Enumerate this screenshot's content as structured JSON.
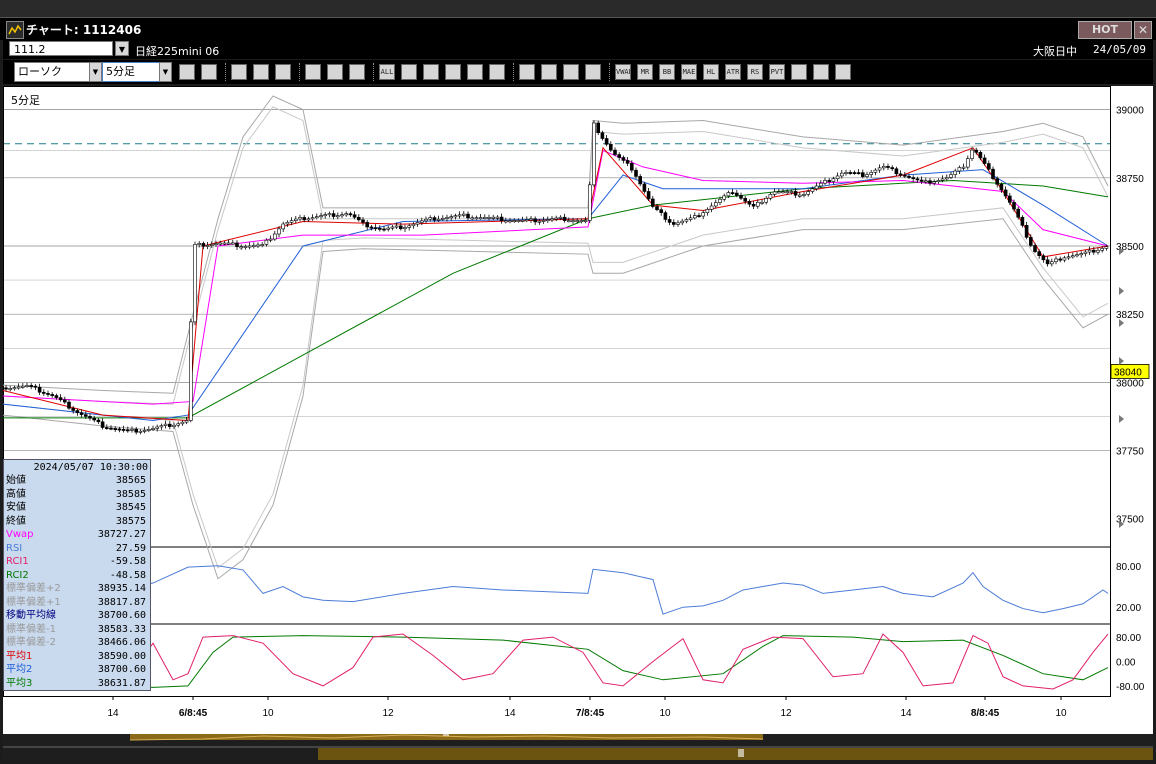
{
  "window": {
    "title": "チャート: 1112406",
    "hot_label": "HOT",
    "close_label": "✕"
  },
  "info": {
    "symbol_code": "111.2",
    "name": "日経225mini 06",
    "exchange": "大阪日中",
    "date": "24/05/09"
  },
  "toolbar": {
    "chart_type": "ローソク",
    "interval": "5分足",
    "buttons": [
      "zoom",
      "range",
      "bug",
      "clock",
      "crosshair",
      "grid",
      "candle",
      "candle2",
      "ALL",
      "pen",
      "line",
      "cursor",
      "undo",
      "note",
      "trash",
      "settings",
      "brush",
      "palette",
      "VWAP",
      "MR",
      "BB",
      "MAE",
      "HL",
      "ATR",
      "RS",
      "PVT",
      "box",
      "Log",
      "export"
    ]
  },
  "chart": {
    "label": "5分足",
    "y_ticks": [
      "39000",
      "38750",
      "38500",
      "38250",
      "38000",
      "37750",
      "37500"
    ],
    "current_price": "38040",
    "rsi_ticks": [
      "80.00",
      "20.00"
    ],
    "rci_ticks": [
      "80.00",
      "0.00",
      "-80.00"
    ],
    "x_ticks": [
      "14",
      "6/8:45",
      "10",
      "12",
      "14",
      "7/8:45",
      "10",
      "12",
      "14",
      "8/8:45",
      "10"
    ],
    "dashed_line_value": 38875
  },
  "datapanel": {
    "timestamp": "2024/05/07  10:30:00",
    "rows": [
      {
        "k": "始値",
        "v": "38565",
        "c": "#000000"
      },
      {
        "k": "高値",
        "v": "38585",
        "c": "#000000"
      },
      {
        "k": "安値",
        "v": "38545",
        "c": "#000000"
      },
      {
        "k": "終値",
        "v": "38575",
        "c": "#000000"
      },
      {
        "k": "Vwap",
        "v": "38727.27",
        "c": "#ff00ff"
      },
      {
        "k": "RSI",
        "v": "27.59",
        "c": "#4c7cd6"
      },
      {
        "k": "RCI1",
        "v": "-59.58",
        "c": "#e0206a"
      },
      {
        "k": "RCI2",
        "v": "-48.58",
        "c": "#007a00"
      },
      {
        "k": "標準偏差+2",
        "v": "38935.14",
        "c": "#9a9a9a"
      },
      {
        "k": "標準偏差+1",
        "v": "38817.87",
        "c": "#9a9a9a"
      },
      {
        "k": "移動平均線",
        "v": "38700.60",
        "c": "#000080"
      },
      {
        "k": "標準偏差-1",
        "v": "38583.33",
        "c": "#9a9a9a"
      },
      {
        "k": "標準偏差-2",
        "v": "38466.06",
        "c": "#9a9a9a"
      },
      {
        "k": "平均1",
        "v": "38590.00",
        "c": "#e00000"
      },
      {
        "k": "平均2",
        "v": "38700.60",
        "c": "#1f5fd8"
      },
      {
        "k": "平均3",
        "v": "38631.87",
        "c": "#007a00"
      }
    ]
  },
  "chart_data": {
    "type": "line",
    "title": "5分足",
    "ylim": [
      37400,
      39050
    ],
    "close_path": [
      [
        0,
        37980
      ],
      [
        25,
        37985
      ],
      [
        50,
        37950
      ],
      [
        75,
        37890
      ],
      [
        100,
        37840
      ],
      [
        125,
        37820
      ],
      [
        150,
        37830
      ],
      [
        175,
        37850
      ],
      [
        185,
        37860
      ],
      [
        190,
        38500
      ],
      [
        215,
        38510
      ],
      [
        240,
        38500
      ],
      [
        260,
        38500
      ],
      [
        280,
        38580
      ],
      [
        300,
        38600
      ],
      [
        320,
        38610
      ],
      [
        345,
        38620
      ],
      [
        360,
        38580
      ],
      [
        380,
        38560
      ],
      [
        400,
        38570
      ],
      [
        430,
        38600
      ],
      [
        460,
        38610
      ],
      [
        490,
        38600
      ],
      [
        520,
        38590
      ],
      [
        560,
        38600
      ],
      [
        585,
        38590
      ],
      [
        590,
        38950
      ],
      [
        610,
        38840
      ],
      [
        630,
        38780
      ],
      [
        650,
        38640
      ],
      [
        670,
        38580
      ],
      [
        690,
        38600
      ],
      [
        710,
        38650
      ],
      [
        730,
        38700
      ],
      [
        750,
        38640
      ],
      [
        770,
        38700
      ],
      [
        800,
        38690
      ],
      [
        815,
        38720
      ],
      [
        840,
        38770
      ],
      [
        860,
        38760
      ],
      [
        880,
        38790
      ],
      [
        900,
        38760
      ],
      [
        920,
        38730
      ],
      [
        945,
        38750
      ],
      [
        960,
        38790
      ],
      [
        970,
        38860
      ],
      [
        985,
        38780
      ],
      [
        1000,
        38700
      ],
      [
        1010,
        38640
      ],
      [
        1030,
        38490
      ],
      [
        1045,
        38430
      ],
      [
        1060,
        38460
      ],
      [
        1080,
        38470
      ],
      [
        1105,
        38500
      ]
    ],
    "bb_upper": [
      [
        0,
        37990
      ],
      [
        100,
        37970
      ],
      [
        170,
        37960
      ],
      [
        190,
        38250
      ],
      [
        215,
        38600
      ],
      [
        240,
        38900
      ],
      [
        270,
        39050
      ],
      [
        300,
        39000
      ],
      [
        320,
        38640
      ],
      [
        360,
        38640
      ],
      [
        585,
        38640
      ],
      [
        590,
        38960
      ],
      [
        620,
        38950
      ],
      [
        700,
        38960
      ],
      [
        800,
        38900
      ],
      [
        900,
        38870
      ],
      [
        1000,
        38920
      ],
      [
        1040,
        38950
      ],
      [
        1080,
        38900
      ],
      [
        1105,
        38720
      ]
    ],
    "bb_lower": [
      [
        0,
        37880
      ],
      [
        100,
        37840
      ],
      [
        170,
        37820
      ],
      [
        190,
        37550
      ],
      [
        215,
        37280
      ],
      [
        240,
        37350
      ],
      [
        270,
        37550
      ],
      [
        300,
        37950
      ],
      [
        320,
        38480
      ],
      [
        360,
        38490
      ],
      [
        585,
        38470
      ],
      [
        590,
        38400
      ],
      [
        620,
        38400
      ],
      [
        700,
        38500
      ],
      [
        800,
        38560
      ],
      [
        900,
        38560
      ],
      [
        1000,
        38600
      ],
      [
        1040,
        38380
      ],
      [
        1080,
        38200
      ],
      [
        1105,
        38250
      ]
    ],
    "vwap": [
      [
        0,
        37950
      ],
      [
        150,
        37920
      ],
      [
        190,
        37930
      ],
      [
        215,
        38500
      ],
      [
        300,
        38540
      ],
      [
        420,
        38540
      ],
      [
        585,
        38570
      ],
      [
        600,
        38850
      ],
      [
        640,
        38790
      ],
      [
        700,
        38740
      ],
      [
        800,
        38730
      ],
      [
        900,
        38740
      ],
      [
        1000,
        38700
      ],
      [
        1040,
        38560
      ],
      [
        1105,
        38500
      ]
    ],
    "ma_short": [
      [
        0,
        37970
      ],
      [
        100,
        37880
      ],
      [
        185,
        37860
      ],
      [
        200,
        38500
      ],
      [
        300,
        38590
      ],
      [
        400,
        38580
      ],
      [
        585,
        38600
      ],
      [
        600,
        38860
      ],
      [
        650,
        38650
      ],
      [
        700,
        38630
      ],
      [
        800,
        38700
      ],
      [
        900,
        38760
      ],
      [
        970,
        38860
      ],
      [
        1000,
        38700
      ],
      [
        1040,
        38460
      ],
      [
        1105,
        38500
      ]
    ],
    "ma_mid": [
      [
        0,
        37920
      ],
      [
        150,
        37860
      ],
      [
        185,
        37880
      ],
      [
        300,
        38500
      ],
      [
        400,
        38590
      ],
      [
        585,
        38600
      ],
      [
        620,
        38760
      ],
      [
        660,
        38710
      ],
      [
        800,
        38710
      ],
      [
        900,
        38760
      ],
      [
        980,
        38780
      ],
      [
        1040,
        38650
      ],
      [
        1105,
        38500
      ]
    ],
    "ma_long": [
      [
        0,
        37870
      ],
      [
        185,
        37870
      ],
      [
        300,
        38100
      ],
      [
        450,
        38400
      ],
      [
        585,
        38600
      ],
      [
        650,
        38650
      ],
      [
        800,
        38710
      ],
      [
        950,
        38740
      ],
      [
        1040,
        38720
      ],
      [
        1105,
        38680
      ]
    ],
    "rsi": [
      [
        0,
        30
      ],
      [
        20,
        45
      ],
      [
        40,
        50
      ],
      [
        60,
        45
      ],
      [
        100,
        40
      ],
      [
        150,
        55
      ],
      [
        185,
        78
      ],
      [
        215,
        80
      ],
      [
        240,
        74
      ],
      [
        260,
        40
      ],
      [
        280,
        50
      ],
      [
        300,
        35
      ],
      [
        320,
        30
      ],
      [
        350,
        28
      ],
      [
        400,
        40
      ],
      [
        450,
        50
      ],
      [
        500,
        45
      ],
      [
        585,
        40
      ],
      [
        590,
        75
      ],
      [
        620,
        70
      ],
      [
        650,
        60
      ],
      [
        660,
        10
      ],
      [
        680,
        20
      ],
      [
        700,
        22
      ],
      [
        720,
        30
      ],
      [
        740,
        45
      ],
      [
        760,
        50
      ],
      [
        780,
        55
      ],
      [
        800,
        52
      ],
      [
        820,
        40
      ],
      [
        850,
        45
      ],
      [
        880,
        50
      ],
      [
        900,
        40
      ],
      [
        930,
        35
      ],
      [
        960,
        55
      ],
      [
        970,
        70
      ],
      [
        980,
        50
      ],
      [
        1000,
        30
      ],
      [
        1020,
        18
      ],
      [
        1040,
        12
      ],
      [
        1060,
        18
      ],
      [
        1080,
        25
      ],
      [
        1100,
        45
      ],
      [
        1105,
        40
      ]
    ],
    "rci1": [
      [
        0,
        40
      ],
      [
        30,
        80
      ],
      [
        60,
        -60
      ],
      [
        90,
        30
      ],
      [
        120,
        -80
      ],
      [
        150,
        60
      ],
      [
        170,
        -60
      ],
      [
        185,
        -40
      ],
      [
        200,
        80
      ],
      [
        230,
        85
      ],
      [
        260,
        60
      ],
      [
        290,
        -40
      ],
      [
        320,
        -80
      ],
      [
        350,
        -20
      ],
      [
        370,
        80
      ],
      [
        400,
        90
      ],
      [
        430,
        20
      ],
      [
        460,
        -60
      ],
      [
        490,
        -40
      ],
      [
        520,
        70
      ],
      [
        550,
        80
      ],
      [
        580,
        30
      ],
      [
        600,
        -70
      ],
      [
        620,
        -80
      ],
      [
        650,
        0
      ],
      [
        680,
        75
      ],
      [
        700,
        -60
      ],
      [
        720,
        -70
      ],
      [
        740,
        40
      ],
      [
        770,
        80
      ],
      [
        800,
        75
      ],
      [
        830,
        -50
      ],
      [
        860,
        -40
      ],
      [
        880,
        90
      ],
      [
        900,
        30
      ],
      [
        920,
        -80
      ],
      [
        950,
        -70
      ],
      [
        970,
        85
      ],
      [
        985,
        60
      ],
      [
        1000,
        -50
      ],
      [
        1020,
        -80
      ],
      [
        1050,
        -90
      ],
      [
        1070,
        -60
      ],
      [
        1090,
        30
      ],
      [
        1105,
        90
      ]
    ],
    "rci2": [
      [
        0,
        -50
      ],
      [
        100,
        -80
      ],
      [
        150,
        -85
      ],
      [
        185,
        -80
      ],
      [
        210,
        30
      ],
      [
        230,
        80
      ],
      [
        300,
        85
      ],
      [
        400,
        80
      ],
      [
        500,
        70
      ],
      [
        585,
        40
      ],
      [
        620,
        -30
      ],
      [
        660,
        -60
      ],
      [
        720,
        -40
      ],
      [
        760,
        50
      ],
      [
        780,
        85
      ],
      [
        850,
        80
      ],
      [
        900,
        65
      ],
      [
        960,
        70
      ],
      [
        1000,
        20
      ],
      [
        1040,
        -40
      ],
      [
        1080,
        -60
      ],
      [
        1105,
        -20
      ]
    ]
  }
}
